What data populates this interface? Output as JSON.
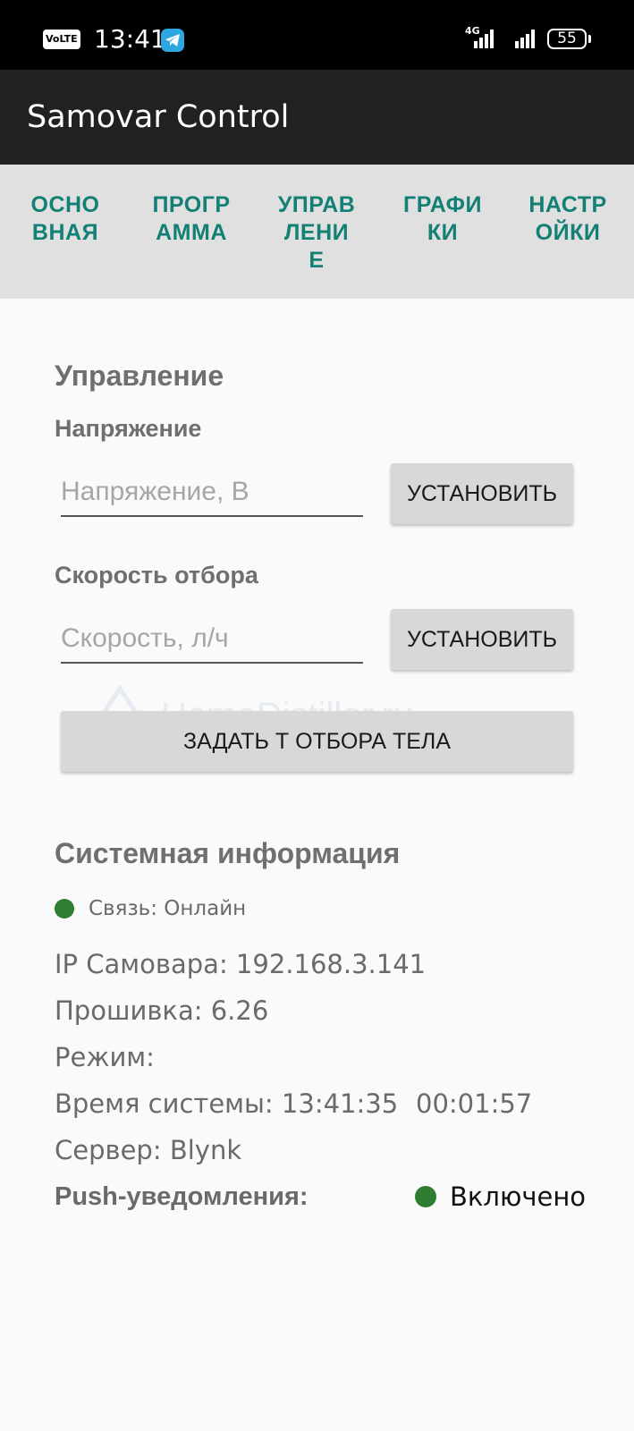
{
  "status_bar": {
    "volte": "VoLTE",
    "time": "13:41",
    "network": "4G",
    "battery": "55"
  },
  "app": {
    "title": "Samovar Control"
  },
  "tabs": [
    {
      "line1": "ОСНО",
      "line2": "ВНАЯ",
      "line3": ""
    },
    {
      "line1": "ПРОГР",
      "line2": "АММА",
      "line3": ""
    },
    {
      "line1": "УПРАВ",
      "line2": "ЛЕНИ",
      "line3": "Е"
    },
    {
      "line1": "ГРАФИ",
      "line2": "КИ",
      "line3": ""
    },
    {
      "line1": "НАСТР",
      "line2": "ОЙКИ",
      "line3": ""
    }
  ],
  "control": {
    "title": "Управление",
    "voltage_label": "Напряжение",
    "voltage_placeholder": "Напряжение, В",
    "voltage_button": "УСТАНОВИТЬ",
    "speed_label": "Скорость отбора",
    "speed_placeholder": "Скорость, л/ч",
    "speed_button": "УСТАНОВИТЬ",
    "body_temp_button": "ЗАДАТЬ Т ОТБОРА ТЕЛА"
  },
  "watermark": "HomeDistiller.ru",
  "system": {
    "title": "Системная информация",
    "connection": "Связь: Онлайн",
    "ip": "IP Самовара: 192.168.3.141",
    "firmware": "Прошивка: 6.26",
    "mode": "Режим:",
    "system_time": "Время системы: 13:41:35",
    "uptime": "00:01:57",
    "server": "Сервер: Blynk",
    "push_label": "Push-уведомления:",
    "push_value": "Включено"
  },
  "colors": {
    "accent": "#128074",
    "online": "#2e7d32"
  }
}
